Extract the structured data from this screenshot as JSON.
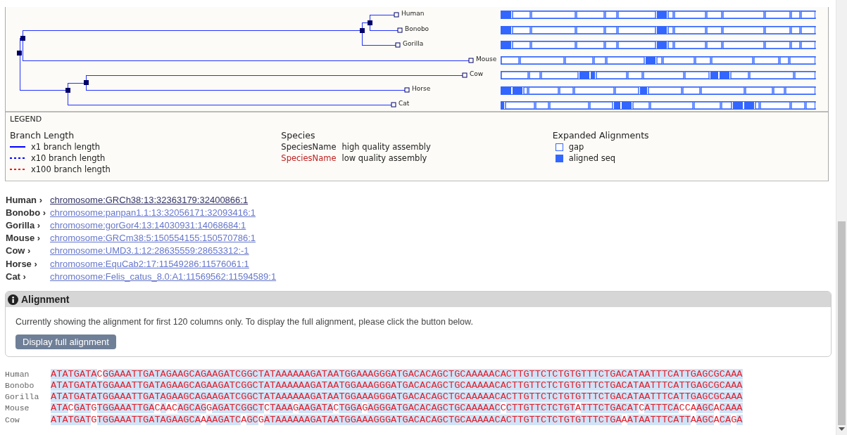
{
  "tree": {
    "leaves": [
      {
        "name": "Human"
      },
      {
        "name": "Bonobo"
      },
      {
        "name": "Gorilla"
      },
      {
        "name": "Mouse"
      },
      {
        "name": "Cow"
      },
      {
        "name": "Horse"
      },
      {
        "name": "Cat"
      }
    ]
  },
  "legend": {
    "title": "LEGEND",
    "branch_length": {
      "heading": "Branch Length",
      "items": [
        {
          "label": "x1 branch length",
          "kind": "solid",
          "color": "#0000ff"
        },
        {
          "label": "x10 branch length",
          "kind": "dashed",
          "color": "#0000ff"
        },
        {
          "label": "x100 branch length",
          "kind": "dashed",
          "color": "#ff0000"
        }
      ]
    },
    "species": {
      "heading": "Species",
      "items": [
        {
          "sample": "SpeciesName",
          "label": "high quality assembly",
          "low_quality": false
        },
        {
          "sample": "SpeciesName",
          "label": "low quality assembly",
          "low_quality": true
        }
      ]
    },
    "expanded": {
      "heading": "Expanded Alignments",
      "items": [
        {
          "label": "gap",
          "kind": "gap"
        },
        {
          "label": "aligned seq",
          "kind": "aligned"
        }
      ]
    }
  },
  "locations": [
    {
      "species": "Human ›",
      "link": "chromosome:GRCh38:13:32363179:32400866:1",
      "visited": true
    },
    {
      "species": "Bonobo ›",
      "link": "chromosome:panpan1.1:13:32056171:32093416:1",
      "visited": false
    },
    {
      "species": "Gorilla ›",
      "link": "chromosome:gorGor4:13:14030931:14068684:1",
      "visited": false
    },
    {
      "species": "Mouse ›",
      "link": "chromosome:GRCm38:5:150554155:150570786:1",
      "visited": false
    },
    {
      "species": "Cow ›",
      "link": "chromosome:UMD3.1:12:28635559:28653312:-1",
      "visited": false
    },
    {
      "species": "Horse ›",
      "link": "chromosome:EquCab2:17:11549286:11576061:1",
      "visited": false
    },
    {
      "species": "Cat ›",
      "link": "chromosome:Felis_catus_8.0:A1:11569562:11594589:1",
      "visited": false
    }
  ],
  "alignment": {
    "title": "Alignment",
    "message": "Currently showing the alignment for first 120 columns only. To display the full alignment, please click the button below.",
    "button": "Display full alignment"
  },
  "sequences": [
    {
      "name": "Human",
      "seq": "ATATGATACGGAAATTGATAGAAGCAGAAGATCGGCTATAAAAAAGATAATGGAAAGGGATGACACAGCTGCAAAAACACTTGTTCTCTGTGTTTCTGACATAATTTCATTGAGCGCAAA"
    },
    {
      "name": "Bonobo",
      "seq": "ATATGATATGGAAATTGATAGAAGCAGAAGATCGGCTATAAAAAAGATAATGGAAAGGGATGACACAGCTGCAAAAACACTTGTTCTCTGTGTTTCTGACATAATTTCATTGAGCGCAAA"
    },
    {
      "name": "Gorilla",
      "seq": "ATATGATATGGAAATTGATAGAAGCAGAAGATCGGCTATAAAAAAGATAATGGAAAGGGATGACACAGCTGCAAAAACACTTGTTCTCTGTGTTTCTGACATAATTTCATTGAGCGCAAA"
    },
    {
      "name": "Mouse",
      "seq": "ATACGATGTGGAAATTGACAACAGCAGGAGATCGGCTCTAAAGAAGATACTGGAGAGGGATGACACAGCTGCAAAAACCCTTGTTCTCTGTATTTCTGACATCATTTCACCAAGCACAAA"
    },
    {
      "name": "Cow",
      "seq": "ATATGATGTGGAAATTGATAGAAGCAAAAGATCAGCGATAAAAAAGATAATGGAAAGGGATGACACAGCTGCAAAAACACTTGTTCTCTGTGTTTCTGAAATAATTTCATTAAGCACAGA"
    }
  ]
}
